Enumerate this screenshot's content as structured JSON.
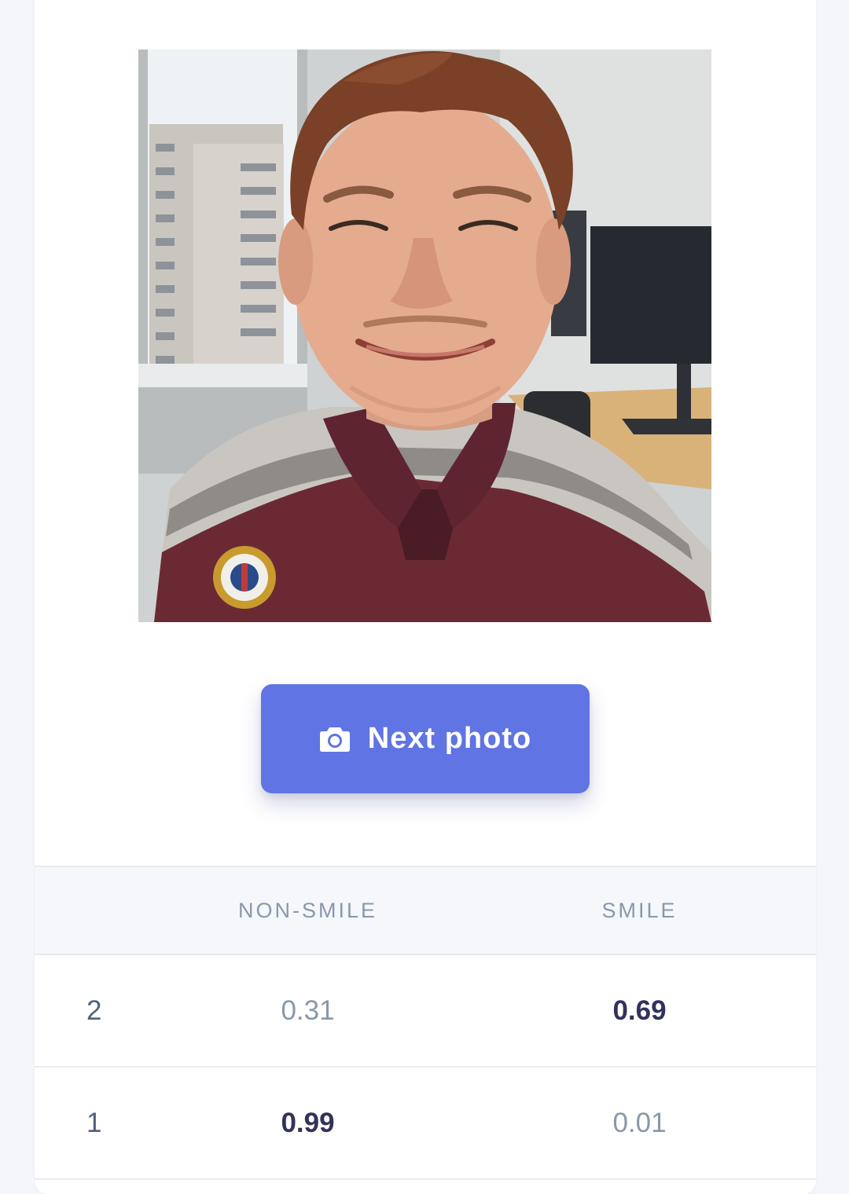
{
  "colors": {
    "accent": "#6074e3",
    "page_bg": "#f4f6fa",
    "header_bg": "#f5f7fb",
    "text_dim": "#8898aa",
    "text_strong": "#32325d"
  },
  "photo": {
    "description_icon": "photo-of-smiling-man"
  },
  "next_button": {
    "icon": "camera-icon",
    "label": "Next photo"
  },
  "results": {
    "columns": [
      "",
      "NON-SMILE",
      "SMILE"
    ],
    "rows": [
      {
        "label": "2",
        "non_smile": "0.31",
        "smile": "0.69"
      },
      {
        "label": "1",
        "non_smile": "0.99",
        "smile": "0.01"
      }
    ]
  }
}
